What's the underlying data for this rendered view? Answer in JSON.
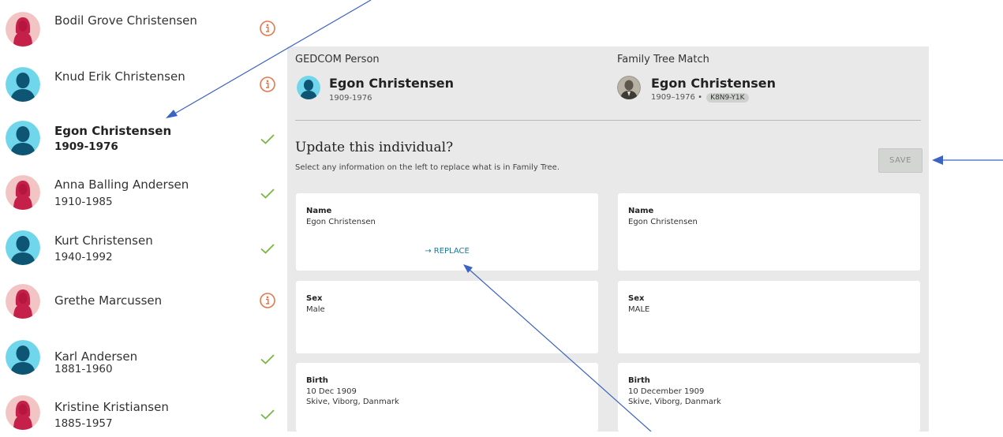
{
  "people": [
    {
      "name": "Bodil Grove Christensen",
      "dates": "",
      "sex": "female",
      "status": "info",
      "selected": false
    },
    {
      "name": "Knud Erik Christensen",
      "dates": "",
      "sex": "male",
      "status": "info",
      "selected": false
    },
    {
      "name": "Egon Christensen",
      "dates": "1909-1976",
      "sex": "male",
      "status": "check",
      "selected": true
    },
    {
      "name": "Anna Balling Andersen",
      "dates": "1910-1985",
      "sex": "female",
      "status": "check",
      "selected": false
    },
    {
      "name": "Kurt Christensen",
      "dates": "1940-1992",
      "sex": "male",
      "status": "check",
      "selected": false
    },
    {
      "name": "Grethe Marcussen",
      "dates": "",
      "sex": "female",
      "status": "info",
      "selected": false
    },
    {
      "name": "Karl Andersen",
      "dates": "1881-1960",
      "sex": "male",
      "status": "check",
      "selected": false
    },
    {
      "name": "Kristine Kristiansen",
      "dates": "1885-1957",
      "sex": "female",
      "status": "check",
      "selected": false
    }
  ],
  "gedcom": {
    "label": "GEDCOM Person",
    "name": "Egon Christensen",
    "dates": "1909-1976"
  },
  "match": {
    "label": "Family Tree Match",
    "name": "Egon Christensen",
    "dates": "1909–1976 •",
    "pid": "K8N9-Y1K"
  },
  "update": {
    "title": "Update this individual?",
    "subtitle": "Select any information on the left to replace what is in Family Tree.",
    "save_label": "SAVE"
  },
  "fields": [
    {
      "label": "Name",
      "left": [
        "Egon Christensen"
      ],
      "right": [
        "Egon Christensen"
      ],
      "replace_label": "→ REPLACE"
    },
    {
      "label": "Sex",
      "left": [
        "Male"
      ],
      "right": [
        "MALE"
      ],
      "replace_label": ""
    },
    {
      "label": "Birth",
      "left": [
        "10 Dec 1909",
        "Skive, Viborg, Danmark"
      ],
      "right": [
        "10 December 1909",
        "Skive, Viborg, Danmark"
      ],
      "replace_label": ""
    }
  ],
  "colors": {
    "male_bg": "#6fd6ec",
    "male_fg": "#0e5574",
    "female_bg": "#f3c4c4",
    "female_fg": "#c4204a",
    "info": "#e8764a",
    "check": "#77b843",
    "link": "#1a7a99",
    "arrow": "#3b63c4"
  }
}
